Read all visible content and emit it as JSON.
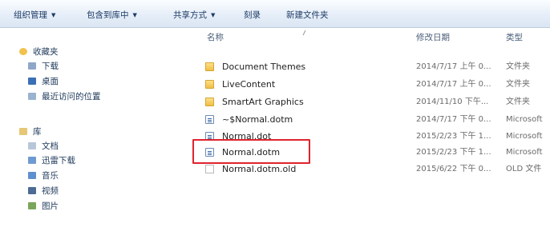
{
  "toolbar": {
    "items": [
      {
        "label": "组织管理",
        "has_dropdown": true
      },
      {
        "label": "包含到库中",
        "has_dropdown": true
      },
      {
        "label": "共享方式",
        "has_dropdown": true
      },
      {
        "label": "刻录",
        "has_dropdown": false
      },
      {
        "label": "新建文件夹",
        "has_dropdown": false
      }
    ]
  },
  "sidebar": {
    "favorites": {
      "label": "收藏夹",
      "items": [
        {
          "label": "下载",
          "icon": "download-icon"
        },
        {
          "label": "桌面",
          "icon": "desktop-icon"
        },
        {
          "label": "最近访问的位置",
          "icon": "recent-places-icon"
        }
      ]
    },
    "libraries": {
      "label": "库",
      "items": [
        {
          "label": "文档",
          "icon": "documents-icon"
        },
        {
          "label": "迅雷下载",
          "icon": "thunder-download-icon"
        },
        {
          "label": "音乐",
          "icon": "music-icon"
        },
        {
          "label": "视频",
          "icon": "video-icon"
        },
        {
          "label": "图片",
          "icon": "pictures-icon"
        }
      ]
    }
  },
  "columns": {
    "name": "名称",
    "date": "修改日期",
    "type": "类型"
  },
  "files": [
    {
      "name": "Document Themes",
      "date": "2014/7/17 上午 0...",
      "type": "文件夹",
      "icon": "folder-icon"
    },
    {
      "name": "LiveContent",
      "date": "2014/7/17 上午 0...",
      "type": "文件夹",
      "icon": "folder-icon"
    },
    {
      "name": "SmartArt Graphics",
      "date": "2014/11/10 下午...",
      "type": "文件夹",
      "icon": "folder-icon"
    },
    {
      "name": "~$Normal.dotm",
      "date": "2014/7/17 下午 0...",
      "type": "Microsoft",
      "icon": "document-icon"
    },
    {
      "name": "Normal.dot",
      "date": "2015/2/23 下午 1...",
      "type": "Microsoft",
      "icon": "document-icon"
    },
    {
      "name": "Normal.dotm",
      "date": "2015/2/23 下午 1...",
      "type": "Microsoft",
      "icon": "document-icon"
    },
    {
      "name": "Normal.dotm.old",
      "date": "2015/6/22 下午 0...",
      "type": "OLD 文件",
      "icon": "file-icon"
    }
  ],
  "highlighted_file": "Normal.dotm",
  "colors": {
    "highlight_border": "#e0232d",
    "toolbar_text": "#1d3b66",
    "folder": "#eebe45",
    "date_text": "#6a6a6a"
  }
}
